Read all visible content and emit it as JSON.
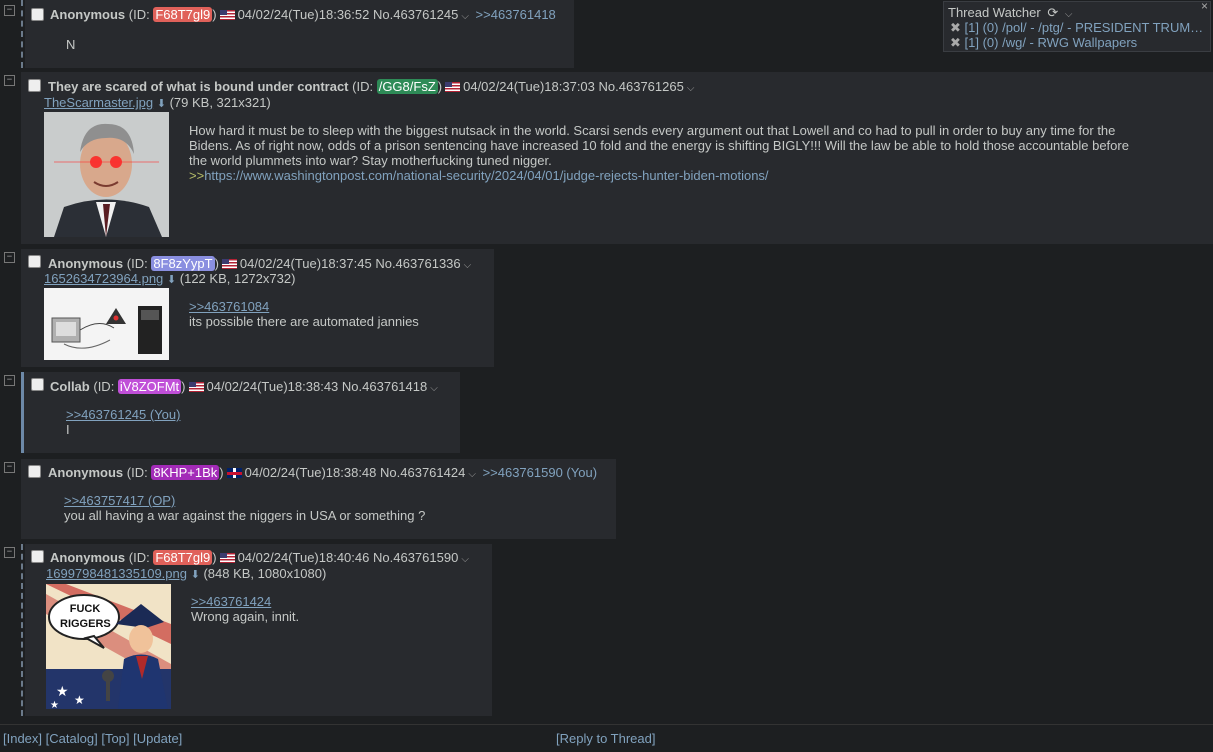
{
  "thread_watcher": {
    "title": "Thread Watcher",
    "close": "×",
    "items": [
      {
        "text": "[1] (0) /pol/ - /ptg/ - PRESIDENT TRUM…"
      },
      {
        "text": "[1] (0) /wg/ - RWG Wallpapers"
      }
    ]
  },
  "posts": [
    {
      "name": "Anonymous",
      "subject": "",
      "id_prefix": "(ID: ",
      "id": "F68T7gl9",
      "id_suffix": ")",
      "id_color": "#e0615a",
      "flag": "us",
      "datetime": "04/02/24(Tue)18:36:52",
      "number": "No.463761245",
      "backlinks": ">>463761418",
      "text": "N"
    },
    {
      "name": "",
      "subject": "They are scared of what is bound under contract",
      "id_prefix": "(ID: ",
      "id": "/GG8/FsZ",
      "id_suffix": ")",
      "id_color": "#2e8b57",
      "flag": "us",
      "datetime": "04/02/24(Tue)18:37:03",
      "number": "No.463761265",
      "file": {
        "name": "TheScarmaster.jpg",
        "meta": "(79 KB, 321x321)"
      },
      "text_lines": [
        "How hard it must be to sleep with the biggest nutsack in the world. Scarsi sends every argument out that Lowell and co had to pull in order to buy any time for the",
        "Bidens. As of right now, odds of a prison sentencing have increased 10 fold and the energy is shifting BIGLY!!! Will the law be able to hold those accountable before",
        "the world plummets into war? Stay motherfucking tuned nigger."
      ],
      "link_prefix": ">>",
      "link": "https://www.washingtonpost.com/national-security/2024/04/01/judge-rejects-hunter-biden-motions/"
    },
    {
      "name": "Anonymous",
      "id_prefix": "(ID: ",
      "id": "8F8zYypT",
      "id_suffix": ")",
      "id_color": "#8a8fe0",
      "flag": "us",
      "datetime": "04/02/24(Tue)18:37:45",
      "number": "No.463761336",
      "file": {
        "name": "1652634723964.png",
        "meta": "(122 KB, 1272x732)"
      },
      "quote": ">>463761084",
      "text": "its possible there are automated jannies"
    },
    {
      "name": "Collab",
      "id_prefix": "(ID: ",
      "id": "iV8ZOFMt",
      "id_suffix": ")",
      "id_color": "#c04fd8",
      "flag": "us",
      "datetime": "04/02/24(Tue)18:38:43",
      "number": "No.463761418",
      "quote": ">>463761245 (You)",
      "text": "I"
    },
    {
      "name": "Anonymous",
      "id_prefix": "(ID: ",
      "id": "8KHP+1Bk",
      "id_suffix": ")",
      "id_color": "#a32bb8",
      "flag": "gb",
      "datetime": "04/02/24(Tue)18:38:48",
      "number": "No.463761424",
      "backlinks": ">>463761590 (You)",
      "quote": ">>463757417 (OP)",
      "text": "you all having a war against the niggers in USA or something ?"
    },
    {
      "name": "Anonymous",
      "id_prefix": "(ID: ",
      "id": "F68T7gl9",
      "id_suffix": ")",
      "id_color": "#e0615a",
      "flag": "us",
      "datetime": "04/02/24(Tue)18:40:46",
      "number": "No.463761590",
      "file": {
        "name": "1699798481335109.png",
        "meta": "(848 KB, 1080x1080)"
      },
      "image_text": "FUCK RIGGERS",
      "quote": ">>463761424",
      "text": "Wrong again, innit."
    }
  ],
  "footer": {
    "index": "[Index]",
    "catalog": "[Catalog]",
    "top": "[Top]",
    "update": "[Update]",
    "reply": "[Reply to Thread]"
  },
  "colors": {
    "background": "#1d1f21",
    "post_bg": "#282a2e",
    "link": "#81a2be",
    "greentext": "#b5bd68"
  }
}
